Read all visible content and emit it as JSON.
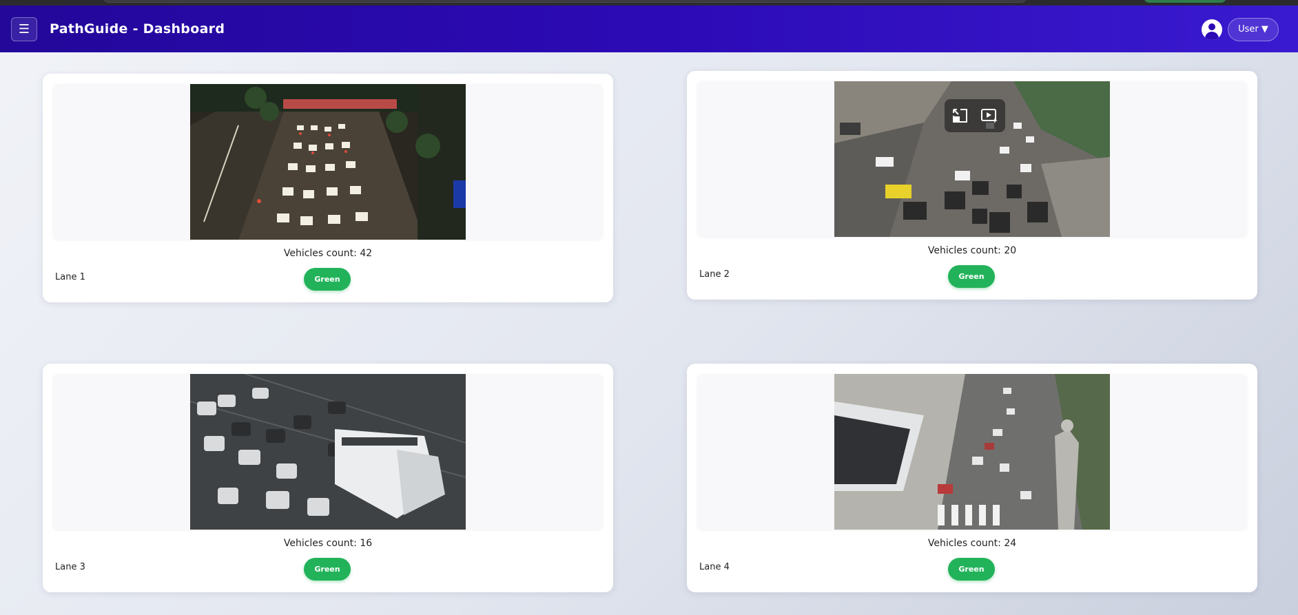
{
  "header": {
    "menu_icon": "☰",
    "title": "PathGuide - Dashboard",
    "user_label": "User ▼"
  },
  "lanes": [
    {
      "count_label": "Vehicles count: 42",
      "lane_label": "Lane 1",
      "status": "Green",
      "scene": "night-traffic"
    },
    {
      "count_label": "Vehicles count: 20",
      "lane_label": "Lane 2",
      "status": "Green",
      "scene": "day-traffic-aerial"
    },
    {
      "count_label": "Vehicles count: 16",
      "lane_label": "Lane 3",
      "status": "Green",
      "scene": "rainy-traffic-bus"
    },
    {
      "count_label": "Vehicles count: 24",
      "lane_label": "Lane 4",
      "status": "Green",
      "scene": "intersection-statue"
    }
  ],
  "colors": {
    "navbar": "#2c0ab5",
    "status_green": "#22b35a"
  }
}
